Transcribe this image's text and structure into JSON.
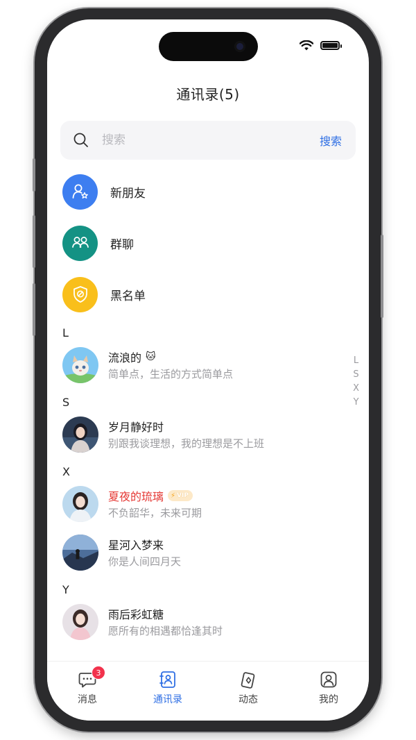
{
  "header": {
    "title": "通讯录(5)"
  },
  "search": {
    "placeholder": "搜索",
    "button_label": "搜索"
  },
  "functions": [
    {
      "label": "新朋友",
      "icon": "new-friend-icon",
      "color": "#3d7ef0"
    },
    {
      "label": "群聊",
      "icon": "group-chat-icon",
      "color": "#149284"
    },
    {
      "label": "黑名单",
      "icon": "blacklist-shield-icon",
      "color": "#f9bf1b"
    }
  ],
  "sections": [
    {
      "letter": "L",
      "contacts": [
        {
          "name": "流浪的",
          "emoji": "🐱",
          "signature": "简单点，生活的方式简单点"
        }
      ]
    },
    {
      "letter": "S",
      "contacts": [
        {
          "name": "岁月静好时",
          "signature": "别跟我谈理想，我的理想是不上班"
        }
      ]
    },
    {
      "letter": "X",
      "contacts": [
        {
          "name": "夏夜的琉璃",
          "vip": "VIP",
          "signature": "不负韶华，未来可期"
        },
        {
          "name": "星河入梦来",
          "signature": "你是人间四月天"
        }
      ]
    },
    {
      "letter": "Y",
      "contacts": [
        {
          "name": "雨后彩虹糖",
          "signature": "愿所有的相遇都恰逢其时"
        }
      ]
    }
  ],
  "index_bar": [
    "L",
    "S",
    "X",
    "Y"
  ],
  "tabs": [
    {
      "label": "消息",
      "badge": "3",
      "icon": "message-icon"
    },
    {
      "label": "通讯录",
      "icon": "contacts-icon",
      "active": true
    },
    {
      "label": "动态",
      "icon": "moments-icon"
    },
    {
      "label": "我的",
      "icon": "profile-icon"
    }
  ],
  "colors": {
    "accent": "#2f6fe4",
    "vip_name": "#e53935",
    "badge": "#f2324c"
  }
}
